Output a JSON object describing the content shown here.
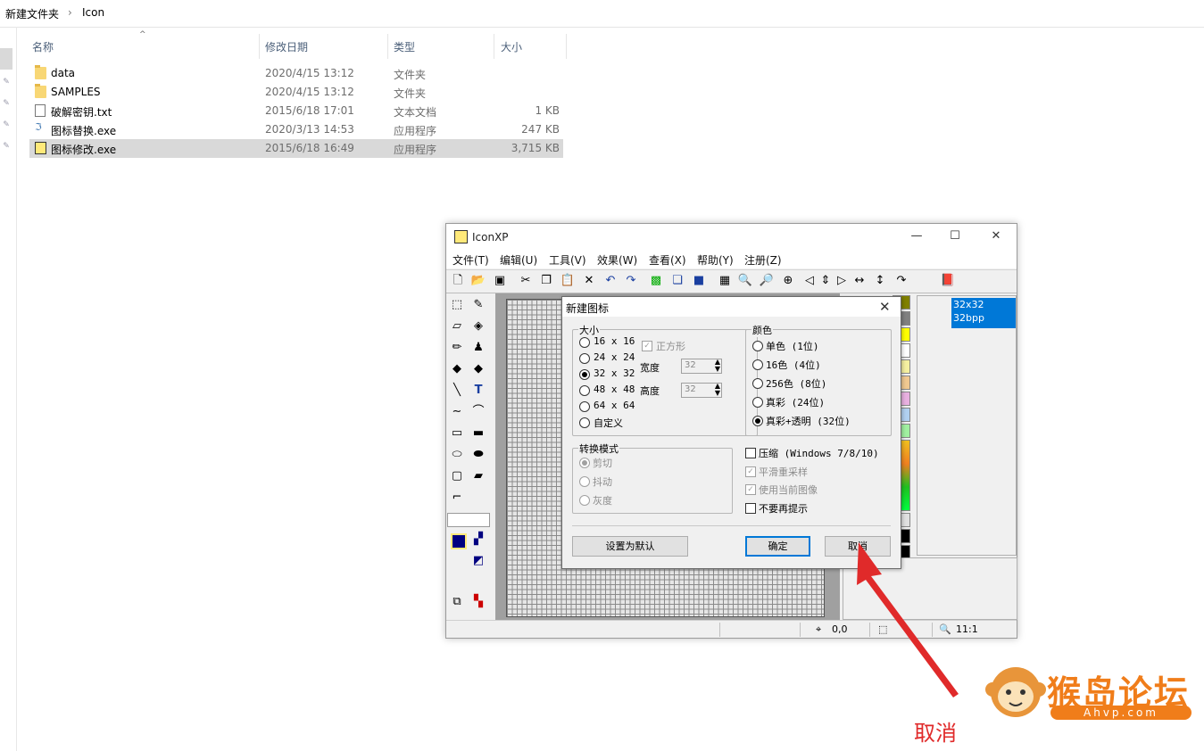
{
  "explorer": {
    "breadcrumb": [
      "新建文件夹",
      "›",
      "Icon"
    ],
    "columns": {
      "name": "名称",
      "modified": "修改日期",
      "type": "类型",
      "size": "大小"
    },
    "files": [
      {
        "name": "data",
        "modified": "2020/4/15 13:12",
        "type": "文件夹",
        "size": "",
        "icon": "folder-icon",
        "selected": false
      },
      {
        "name": "SAMPLES",
        "modified": "2020/4/15 13:12",
        "type": "文件夹",
        "size": "",
        "icon": "folder-icon",
        "selected": false
      },
      {
        "name": "破解密钥.txt",
        "modified": "2015/6/18 17:01",
        "type": "文本文档",
        "size": "1 KB",
        "icon": "text-file-icon",
        "selected": false
      },
      {
        "name": "图标替换.exe",
        "modified": "2020/3/13 14:53",
        "type": "应用程序",
        "size": "247 KB",
        "icon": "app-icon",
        "selected": false
      },
      {
        "name": "图标修改.exe",
        "modified": "2015/6/18 16:49",
        "type": "应用程序",
        "size": "3,715 KB",
        "icon": "iconxp-app-icon",
        "selected": true
      }
    ]
  },
  "iconxp": {
    "title": "IconXP",
    "window_controls": {
      "minimize": "—",
      "maximize": "☐",
      "close": "✕"
    },
    "menu": [
      "文件(T)",
      "编辑(U)",
      "工具(V)",
      "效果(W)",
      "查看(X)",
      "帮助(Y)",
      "注册(Z)"
    ],
    "preview_item": [
      "32x32",
      "32bpp"
    ],
    "status": {
      "coords": "0,0",
      "zoom": "11:1"
    }
  },
  "dialog": {
    "title": "新建图标",
    "close": "✕",
    "size_group": {
      "label": "大小",
      "options": [
        "16 x 16",
        "24 x 24",
        "32 x 32",
        "48 x 48",
        "64 x 64",
        "自定义"
      ],
      "selected_index": 2,
      "square_label": "正方形",
      "width_label": "宽度",
      "width_value": "32",
      "height_label": "高度",
      "height_value": "32"
    },
    "color_group": {
      "label": "颜色",
      "options": [
        "单色 (1位)",
        "16色 (4位)",
        "256色 (8位)",
        "真彩 (24位)",
        "真彩+透明 (32位)"
      ],
      "selected_index": 4
    },
    "convert_group": {
      "label": "转换模式",
      "options": [
        "剪切",
        "抖动",
        "灰度"
      ],
      "selected_index": 0
    },
    "checks": [
      {
        "label": "压缩 (Windows 7/8/10)",
        "checked": false,
        "disabled": false
      },
      {
        "label": "平滑重采样",
        "checked": true,
        "disabled": true
      },
      {
        "label": "使用当前图像",
        "checked": true,
        "disabled": true
      },
      {
        "label": "不要再提示",
        "checked": false,
        "disabled": false
      }
    ],
    "buttons": {
      "set_default": "设置为默认",
      "ok": "确定",
      "cancel": "取消"
    }
  },
  "annotation": {
    "arrow_label": "取消",
    "color": "#e02a2a"
  },
  "watermark": {
    "brand": "猴岛论坛",
    "url": "Ahvp.com"
  }
}
